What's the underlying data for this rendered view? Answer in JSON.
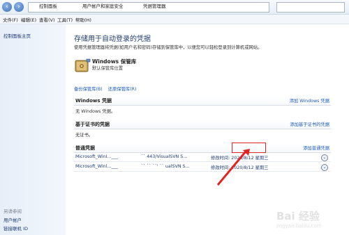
{
  "address_bar": {
    "back_icon": "back-arrow-icon",
    "forward_icon": "forward-arrow-icon",
    "breadcrumbs": [
      "控制面板",
      "用户帐户和家庭安全",
      "凭据管理器"
    ]
  },
  "menu": [
    "文件(F)",
    "编辑(E)",
    "查看(V)",
    "工具(T)",
    "帮助(H)"
  ],
  "sidebar": {
    "home": "控制面板主页",
    "see_also": "另请参阅",
    "links": [
      "用户帐户",
      "链接联机 ID"
    ]
  },
  "main": {
    "title": "存储用于自动登录的凭据",
    "description": "使用凭据管理器将凭据(如用户名和密码)存储到保管库中，以便您可以轻松登录到计算机或网站。",
    "vault_title": "Windows 保管库",
    "vault_sub": "默认保管库位置",
    "backup_link": "备份保管库(B)",
    "restore_link": "还原保管库(R)"
  },
  "sections": {
    "windows": {
      "title": "Windows 凭据",
      "action": "添加 Windows 凭据",
      "empty": "无 Windows 凭据。"
    },
    "cert": {
      "title": "基于证书的凭据",
      "action": "添加基于证书的凭据",
      "empty": "无证书。"
    },
    "generic": {
      "title": "普通凭据",
      "action": "添加普通凭据",
      "rows": [
        {
          "name": "Microsoft_WinI...___",
          "target": "`` 443/VisualSVN S...",
          "modified": "修改时间: 2020/8/12 星期三"
        },
        {
          "name": "Microsoft_Winl...___",
          "target": "`` `` ``' `` ualSVN S...",
          "modified": "修改时间: 2020/8/12 星期三"
        }
      ]
    }
  },
  "watermark": {
    "main": "Bai 经验",
    "sub": "jingyan.baidu.com"
  },
  "colors": {
    "link": "#1d5dbf",
    "highlight": "#e0241f",
    "header_text": "#1f3d70"
  }
}
